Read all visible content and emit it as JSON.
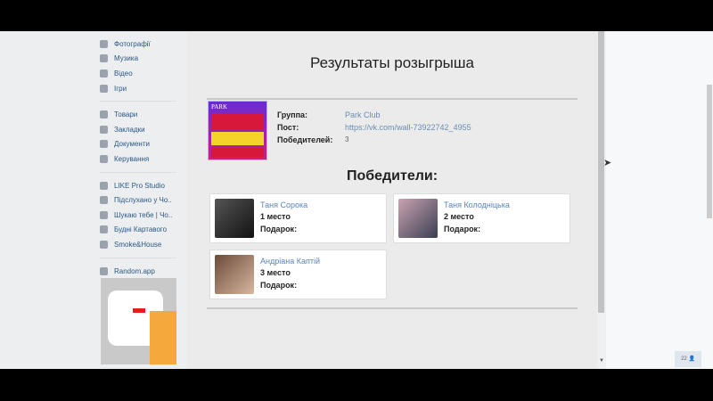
{
  "sidebar": {
    "groups": [
      [
        {
          "label": "Фотографії",
          "icon": "camera-icon"
        },
        {
          "label": "Музика",
          "icon": "music-icon"
        },
        {
          "label": "Відео",
          "icon": "video-icon"
        },
        {
          "label": "Ігри",
          "icon": "gamepad-icon"
        }
      ],
      [
        {
          "label": "Товари",
          "icon": "bag-icon"
        },
        {
          "label": "Закладки",
          "icon": "star-icon"
        },
        {
          "label": "Документи",
          "icon": "document-icon"
        },
        {
          "label": "Керування",
          "icon": "gamepad-icon"
        }
      ],
      [
        {
          "label": "LIKE Pro Studio",
          "icon": "group-icon"
        },
        {
          "label": "Підслухано у Чо..",
          "icon": "group-icon"
        },
        {
          "label": "Шукаю тебе | Чо..",
          "icon": "group-icon"
        },
        {
          "label": "Будні Картавого",
          "icon": "group-icon"
        },
        {
          "label": "Smoke&House",
          "icon": "group-icon"
        }
      ],
      [
        {
          "label": "Random.app",
          "icon": "apps-icon"
        }
      ]
    ]
  },
  "app": {
    "title": "Результаты розыгрыша",
    "cover_text": "PARK",
    "info": {
      "group_label": "Группа:",
      "group_value": "Park Club",
      "post_label": "Пост:",
      "post_value": "https://vk.com/wall-73922742_4955",
      "winners_count_label": "Победителей:",
      "winners_count_value": "3"
    },
    "winners_title": "Победители:",
    "winners": [
      {
        "name": "Таня Сорока",
        "place": "1 место",
        "gift": "Подарок:"
      },
      {
        "name": "Таня Колодніцька",
        "place": "2 место",
        "gift": "Подарок:"
      },
      {
        "name": "Андріана Каптій",
        "place": "3 место",
        "gift": "Подарок:"
      }
    ]
  },
  "badge": "22"
}
